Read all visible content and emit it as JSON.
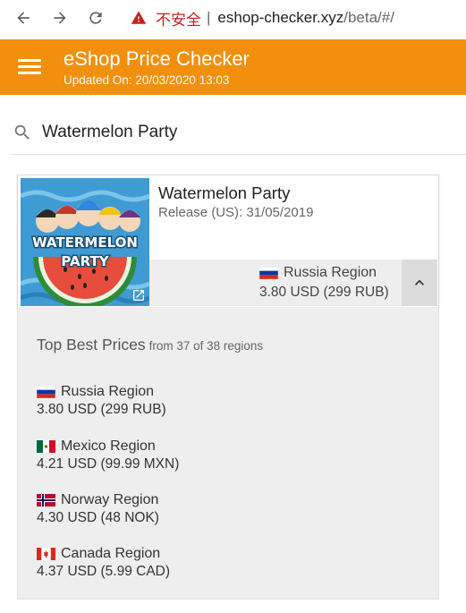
{
  "browser": {
    "insecure_label": "不安全",
    "separator": "|",
    "url_host": "eshop-checker.xyz",
    "url_path": "/beta/#/"
  },
  "app": {
    "title": "eShop Price Checker",
    "updated": "Updated On: 20/03/2020 13:03",
    "color": "#f2900e"
  },
  "search": {
    "value": "Watermelon Party"
  },
  "game": {
    "title": "Watermelon Party",
    "release": "Release (US): 31/05/2019",
    "thumb_text_1": "WATERMELON",
    "thumb_text_2": "PARTY",
    "best_region": "Russia Region",
    "best_price": "3.80 USD (299 RUB)"
  },
  "panel": {
    "heading": "Top Best Prices",
    "sub": "from 37 of 38 regions",
    "regions": [
      {
        "name": "Russia Region",
        "price": "3.80 USD (299 RUB)",
        "flag": "russia-flag"
      },
      {
        "name": "Mexico Region",
        "price": "4.21 USD (99.99 MXN)",
        "flag": "mexico-flag"
      },
      {
        "name": "Norway Region",
        "price": "4.30 USD (48 NOK)",
        "flag": "norway-flag"
      },
      {
        "name": "Canada Region",
        "price": "4.37 USD (5.99 CAD)",
        "flag": "canada-flag"
      }
    ]
  }
}
